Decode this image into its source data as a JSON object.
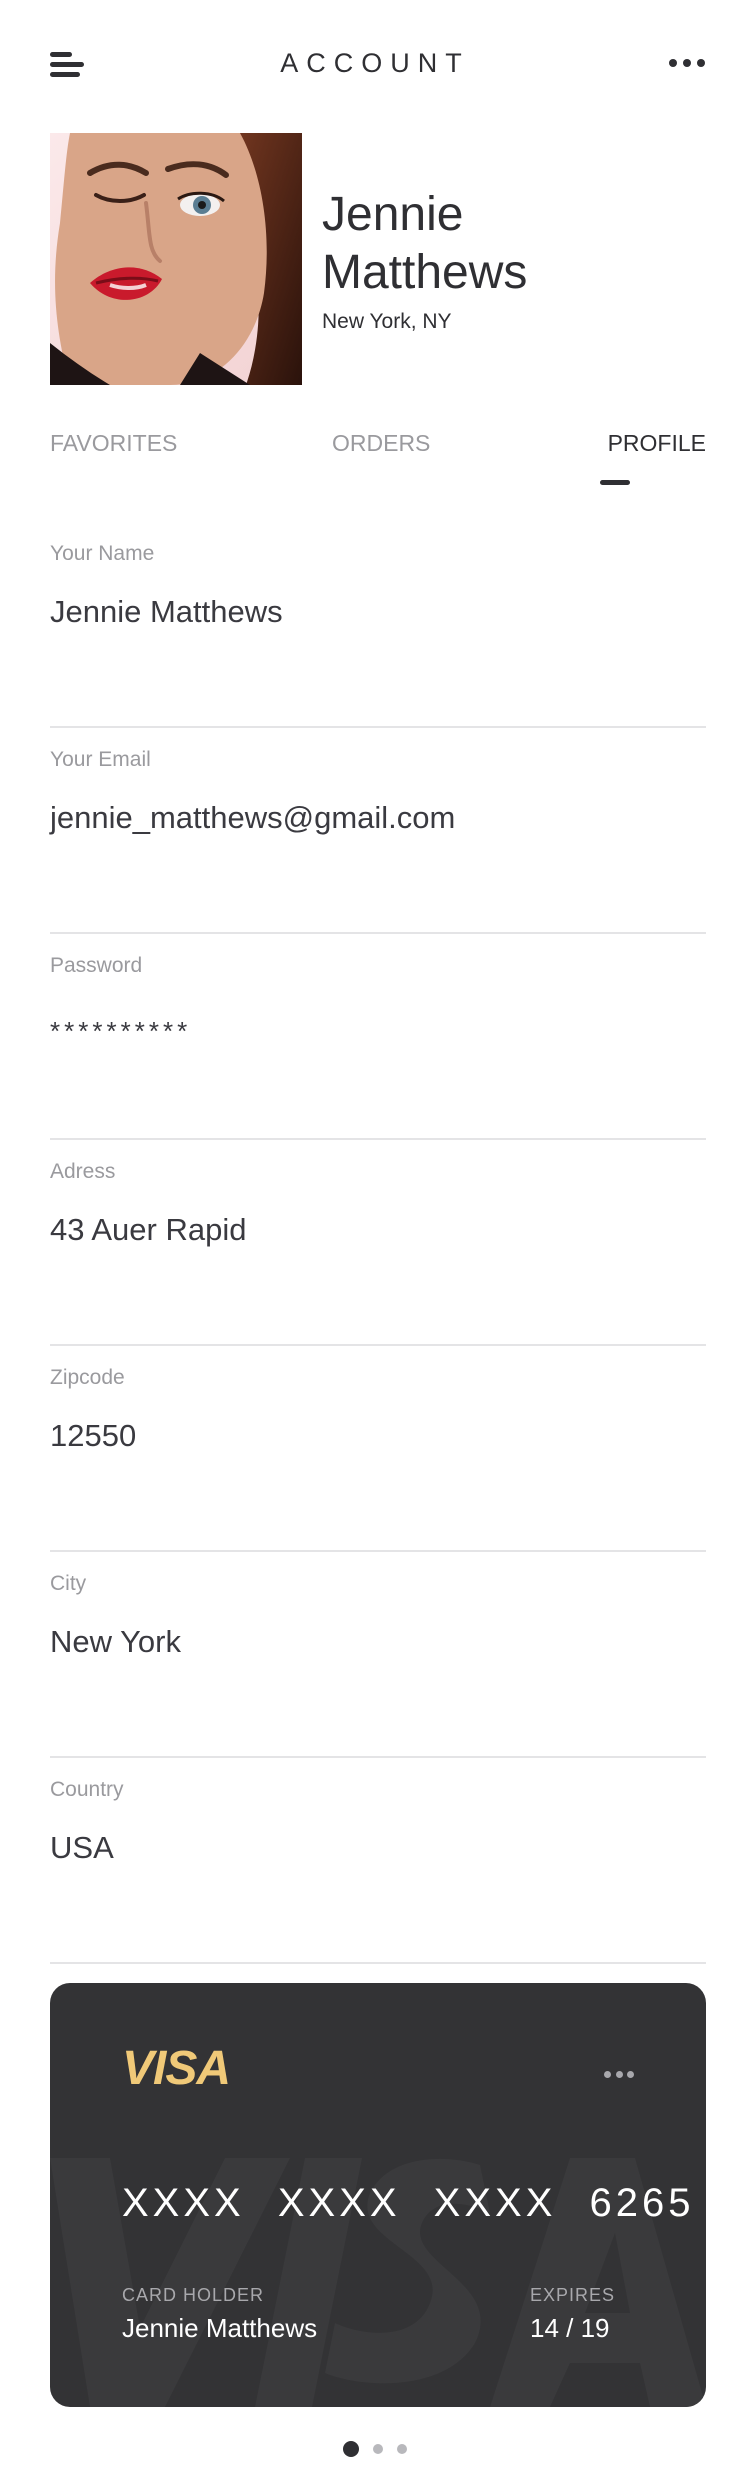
{
  "header": {
    "title": "ACCOUNT",
    "menu_icon": "hamburger-menu-icon",
    "more_icon": "more-horizontal-icon"
  },
  "profile": {
    "name_line1": "Jennie",
    "name_line2": "Matthews",
    "location": "New York, NY"
  },
  "tabs": [
    {
      "label": "FAVORITES",
      "active": false
    },
    {
      "label": "ORDERS",
      "active": false
    },
    {
      "label": "PROFILE",
      "active": true
    }
  ],
  "fields": [
    {
      "label": "Your Name",
      "value": "Jennie Matthews"
    },
    {
      "label": "Your Email",
      "value": "jennie_matthews@gmail.com"
    },
    {
      "label": "Password",
      "value": "**********"
    },
    {
      "label": "Adress",
      "value": "43 Auer Rapid"
    },
    {
      "label": "Zipcode",
      "value": "12550"
    },
    {
      "label": "City",
      "value": "New York"
    },
    {
      "label": "Country",
      "value": "USA"
    }
  ],
  "card": {
    "brand": "VISA",
    "number": "XXXX XXXX XXXX 6265",
    "holder_label": "CARD HOLDER",
    "holder_name": "Jennie Matthews",
    "expires_label": "EXPIRES",
    "expires_value": "14 / 19",
    "background_color": "#333335",
    "brand_color": "#f0c978"
  },
  "pagination": {
    "count": 3,
    "active_index": 0
  }
}
